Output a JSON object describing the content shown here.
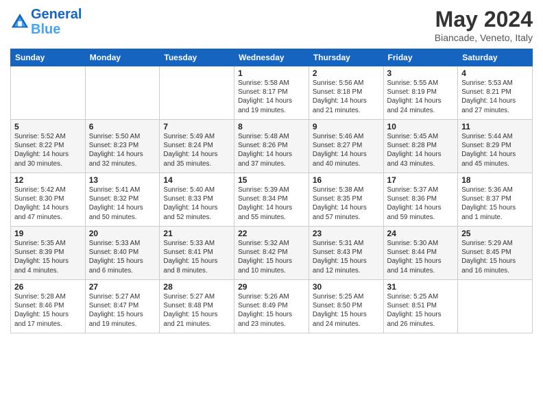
{
  "header": {
    "logo_line1": "General",
    "logo_line2": "Blue",
    "main_title": "May 2024",
    "subtitle": "Biancade, Veneto, Italy"
  },
  "days": [
    "Sunday",
    "Monday",
    "Tuesday",
    "Wednesday",
    "Thursday",
    "Friday",
    "Saturday"
  ],
  "weeks": [
    [
      {
        "date": "",
        "sunrise": "",
        "sunset": "",
        "daylight": ""
      },
      {
        "date": "",
        "sunrise": "",
        "sunset": "",
        "daylight": ""
      },
      {
        "date": "",
        "sunrise": "",
        "sunset": "",
        "daylight": ""
      },
      {
        "date": "1",
        "sunrise": "Sunrise: 5:58 AM",
        "sunset": "Sunset: 8:17 PM",
        "daylight": "Daylight: 14 hours and 19 minutes."
      },
      {
        "date": "2",
        "sunrise": "Sunrise: 5:56 AM",
        "sunset": "Sunset: 8:18 PM",
        "daylight": "Daylight: 14 hours and 21 minutes."
      },
      {
        "date": "3",
        "sunrise": "Sunrise: 5:55 AM",
        "sunset": "Sunset: 8:19 PM",
        "daylight": "Daylight: 14 hours and 24 minutes."
      },
      {
        "date": "4",
        "sunrise": "Sunrise: 5:53 AM",
        "sunset": "Sunset: 8:21 PM",
        "daylight": "Daylight: 14 hours and 27 minutes."
      }
    ],
    [
      {
        "date": "5",
        "sunrise": "Sunrise: 5:52 AM",
        "sunset": "Sunset: 8:22 PM",
        "daylight": "Daylight: 14 hours and 30 minutes."
      },
      {
        "date": "6",
        "sunrise": "Sunrise: 5:50 AM",
        "sunset": "Sunset: 8:23 PM",
        "daylight": "Daylight: 14 hours and 32 minutes."
      },
      {
        "date": "7",
        "sunrise": "Sunrise: 5:49 AM",
        "sunset": "Sunset: 8:24 PM",
        "daylight": "Daylight: 14 hours and 35 minutes."
      },
      {
        "date": "8",
        "sunrise": "Sunrise: 5:48 AM",
        "sunset": "Sunset: 8:26 PM",
        "daylight": "Daylight: 14 hours and 37 minutes."
      },
      {
        "date": "9",
        "sunrise": "Sunrise: 5:46 AM",
        "sunset": "Sunset: 8:27 PM",
        "daylight": "Daylight: 14 hours and 40 minutes."
      },
      {
        "date": "10",
        "sunrise": "Sunrise: 5:45 AM",
        "sunset": "Sunset: 8:28 PM",
        "daylight": "Daylight: 14 hours and 43 minutes."
      },
      {
        "date": "11",
        "sunrise": "Sunrise: 5:44 AM",
        "sunset": "Sunset: 8:29 PM",
        "daylight": "Daylight: 14 hours and 45 minutes."
      }
    ],
    [
      {
        "date": "12",
        "sunrise": "Sunrise: 5:42 AM",
        "sunset": "Sunset: 8:30 PM",
        "daylight": "Daylight: 14 hours and 47 minutes."
      },
      {
        "date": "13",
        "sunrise": "Sunrise: 5:41 AM",
        "sunset": "Sunset: 8:32 PM",
        "daylight": "Daylight: 14 hours and 50 minutes."
      },
      {
        "date": "14",
        "sunrise": "Sunrise: 5:40 AM",
        "sunset": "Sunset: 8:33 PM",
        "daylight": "Daylight: 14 hours and 52 minutes."
      },
      {
        "date": "15",
        "sunrise": "Sunrise: 5:39 AM",
        "sunset": "Sunset: 8:34 PM",
        "daylight": "Daylight: 14 hours and 55 minutes."
      },
      {
        "date": "16",
        "sunrise": "Sunrise: 5:38 AM",
        "sunset": "Sunset: 8:35 PM",
        "daylight": "Daylight: 14 hours and 57 minutes."
      },
      {
        "date": "17",
        "sunrise": "Sunrise: 5:37 AM",
        "sunset": "Sunset: 8:36 PM",
        "daylight": "Daylight: 14 hours and 59 minutes."
      },
      {
        "date": "18",
        "sunrise": "Sunrise: 5:36 AM",
        "sunset": "Sunset: 8:37 PM",
        "daylight": "Daylight: 15 hours and 1 minute."
      }
    ],
    [
      {
        "date": "19",
        "sunrise": "Sunrise: 5:35 AM",
        "sunset": "Sunset: 8:39 PM",
        "daylight": "Daylight: 15 hours and 4 minutes."
      },
      {
        "date": "20",
        "sunrise": "Sunrise: 5:33 AM",
        "sunset": "Sunset: 8:40 PM",
        "daylight": "Daylight: 15 hours and 6 minutes."
      },
      {
        "date": "21",
        "sunrise": "Sunrise: 5:33 AM",
        "sunset": "Sunset: 8:41 PM",
        "daylight": "Daylight: 15 hours and 8 minutes."
      },
      {
        "date": "22",
        "sunrise": "Sunrise: 5:32 AM",
        "sunset": "Sunset: 8:42 PM",
        "daylight": "Daylight: 15 hours and 10 minutes."
      },
      {
        "date": "23",
        "sunrise": "Sunrise: 5:31 AM",
        "sunset": "Sunset: 8:43 PM",
        "daylight": "Daylight: 15 hours and 12 minutes."
      },
      {
        "date": "24",
        "sunrise": "Sunrise: 5:30 AM",
        "sunset": "Sunset: 8:44 PM",
        "daylight": "Daylight: 15 hours and 14 minutes."
      },
      {
        "date": "25",
        "sunrise": "Sunrise: 5:29 AM",
        "sunset": "Sunset: 8:45 PM",
        "daylight": "Daylight: 15 hours and 16 minutes."
      }
    ],
    [
      {
        "date": "26",
        "sunrise": "Sunrise: 5:28 AM",
        "sunset": "Sunset: 8:46 PM",
        "daylight": "Daylight: 15 hours and 17 minutes."
      },
      {
        "date": "27",
        "sunrise": "Sunrise: 5:27 AM",
        "sunset": "Sunset: 8:47 PM",
        "daylight": "Daylight: 15 hours and 19 minutes."
      },
      {
        "date": "28",
        "sunrise": "Sunrise: 5:27 AM",
        "sunset": "Sunset: 8:48 PM",
        "daylight": "Daylight: 15 hours and 21 minutes."
      },
      {
        "date": "29",
        "sunrise": "Sunrise: 5:26 AM",
        "sunset": "Sunset: 8:49 PM",
        "daylight": "Daylight: 15 hours and 23 minutes."
      },
      {
        "date": "30",
        "sunrise": "Sunrise: 5:25 AM",
        "sunset": "Sunset: 8:50 PM",
        "daylight": "Daylight: 15 hours and 24 minutes."
      },
      {
        "date": "31",
        "sunrise": "Sunrise: 5:25 AM",
        "sunset": "Sunset: 8:51 PM",
        "daylight": "Daylight: 15 hours and 26 minutes."
      },
      {
        "date": "",
        "sunrise": "",
        "sunset": "",
        "daylight": ""
      }
    ]
  ]
}
